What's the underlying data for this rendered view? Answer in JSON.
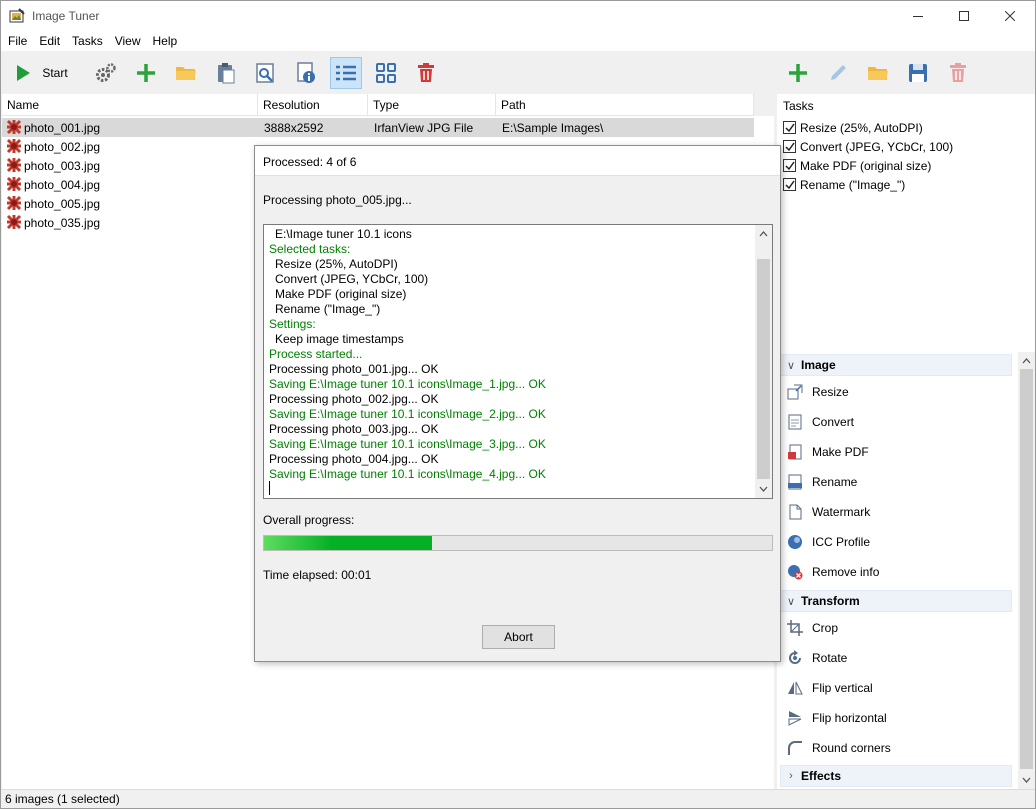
{
  "window": {
    "title": "Image Tuner"
  },
  "menu": [
    "File",
    "Edit",
    "Tasks",
    "View",
    "Help"
  ],
  "toolbar": {
    "start_label": "Start"
  },
  "filelist": {
    "columns": [
      "Name",
      "Resolution",
      "Type",
      "Path"
    ],
    "rows": [
      {
        "name": "photo_001.jpg",
        "resolution": "3888x2592",
        "type": "IrfanView JPG File",
        "path": "E:\\Sample Images\\"
      },
      {
        "name": "photo_002.jpg",
        "resolution": "",
        "type": "",
        "path": ""
      },
      {
        "name": "photo_003.jpg",
        "resolution": "",
        "type": "",
        "path": ""
      },
      {
        "name": "photo_004.jpg",
        "resolution": "",
        "type": "",
        "path": ""
      },
      {
        "name": "photo_005.jpg",
        "resolution": "",
        "type": "",
        "path": ""
      },
      {
        "name": "photo_035.jpg",
        "resolution": "",
        "type": "",
        "path": ""
      }
    ]
  },
  "statusbar": {
    "text": "6 images (1 selected)"
  },
  "tasks": {
    "header": "Tasks",
    "items": [
      "Resize (25%, AutoDPI)",
      "Convert (JPEG, YCbCr, 100)",
      "Make PDF (original size)",
      "Rename (\"Image_\")"
    ]
  },
  "actions": {
    "image": {
      "title": "Image",
      "items": [
        "Resize",
        "Convert",
        "Make PDF",
        "Rename",
        "Watermark",
        "ICC Profile",
        "Remove info"
      ]
    },
    "transform": {
      "title": "Transform",
      "items": [
        "Crop",
        "Rotate",
        "Flip vertical",
        "Flip horizontal",
        "Round corners"
      ]
    },
    "effects": {
      "title": "Effects"
    }
  },
  "dialog": {
    "processed": "Processed: 4 of 6",
    "current": "Processing photo_005.jpg...",
    "log": [
      {
        "text": "E:\\Image tuner 10.1 icons",
        "color": "black",
        "indent": true
      },
      {
        "text": "Selected tasks:",
        "color": "green",
        "indent": false
      },
      {
        "text": "Resize (25%, AutoDPI)",
        "color": "black",
        "indent": true
      },
      {
        "text": "Convert (JPEG, YCbCr, 100)",
        "color": "black",
        "indent": true
      },
      {
        "text": "Make PDF (original size)",
        "color": "black",
        "indent": true
      },
      {
        "text": "Rename (\"Image_\")",
        "color": "black",
        "indent": true
      },
      {
        "text": "Settings:",
        "color": "green",
        "indent": false
      },
      {
        "text": "Keep image timestamps",
        "color": "black",
        "indent": true
      },
      {
        "text": "Process started...",
        "color": "green",
        "indent": false
      },
      {
        "text": "Processing photo_001.jpg... OK",
        "color": "black",
        "indent": false
      },
      {
        "text": "Saving E:\\Image tuner 10.1 icons\\Image_1.jpg... OK",
        "color": "green",
        "indent": false
      },
      {
        "text": "Processing photo_002.jpg... OK",
        "color": "black",
        "indent": false
      },
      {
        "text": "Saving E:\\Image tuner 10.1 icons\\Image_2.jpg... OK",
        "color": "green",
        "indent": false
      },
      {
        "text": "Processing photo_003.jpg... OK",
        "color": "black",
        "indent": false
      },
      {
        "text": "Saving E:\\Image tuner 10.1 icons\\Image_3.jpg... OK",
        "color": "green",
        "indent": false
      },
      {
        "text": "Processing photo_004.jpg... OK",
        "color": "black",
        "indent": false
      },
      {
        "text": "Saving E:\\Image tuner 10.1 icons\\Image_4.jpg... OK",
        "color": "green",
        "indent": false
      }
    ],
    "overall_label": "Overall progress:",
    "progress_fraction": 0.33,
    "time_elapsed": "Time elapsed: 00:01",
    "abort_label": "Abort"
  },
  "colors": {
    "green_text": "#008000",
    "progress_green": "#06b025",
    "selection_blue": "#cce4f7"
  }
}
